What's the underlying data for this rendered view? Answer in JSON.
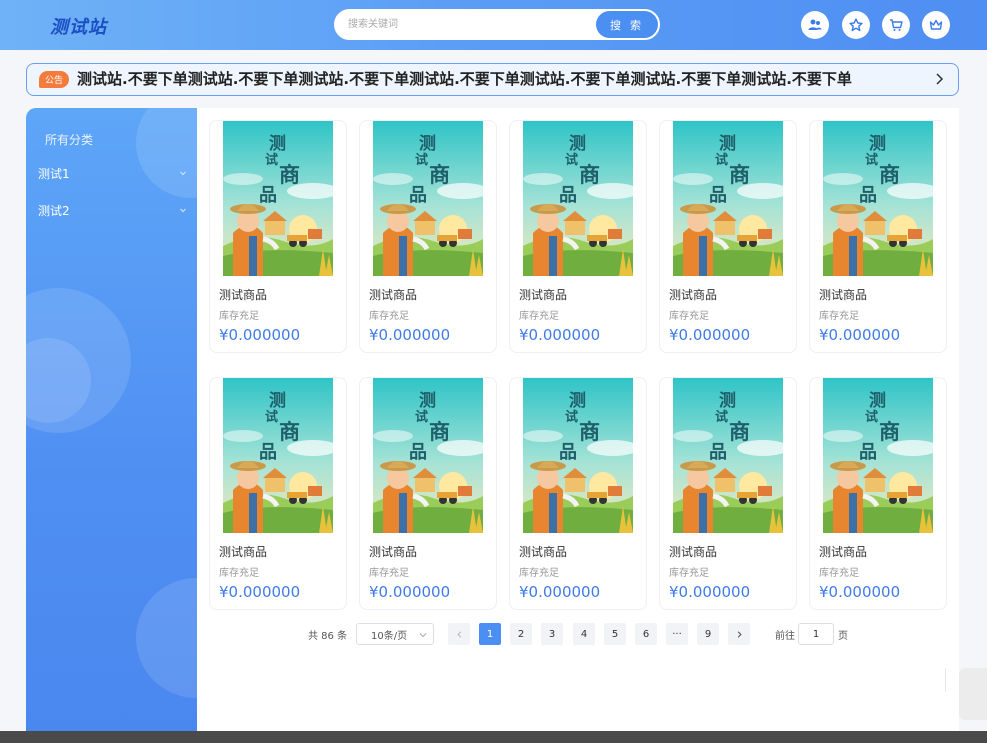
{
  "header": {
    "logo": "测试站",
    "search_placeholder": "搜索关键词",
    "search_button": "搜 索"
  },
  "notice": {
    "tag": "公告",
    "text": "测试站.不要下单测试站.不要下单测试站.不要下单测试站.不要下单测试站.不要下单测试站.不要下单测试站.不要下单"
  },
  "sidebar": {
    "title": "所有分类",
    "items": [
      {
        "label": "测试1"
      },
      {
        "label": "测试2"
      }
    ]
  },
  "products": [
    {
      "name": "测试商品",
      "stock": "库存充足",
      "price": "¥0.000000",
      "poster": [
        "测",
        "试",
        "商",
        "品"
      ]
    },
    {
      "name": "测试商品",
      "stock": "库存充足",
      "price": "¥0.000000",
      "poster": [
        "测",
        "试",
        "商",
        "品"
      ]
    },
    {
      "name": "测试商品",
      "stock": "库存充足",
      "price": "¥0.000000",
      "poster": [
        "测",
        "试",
        "商",
        "品"
      ]
    },
    {
      "name": "测试商品",
      "stock": "库存充足",
      "price": "¥0.000000",
      "poster": [
        "测",
        "试",
        "商",
        "品"
      ]
    },
    {
      "name": "测试商品",
      "stock": "库存充足",
      "price": "¥0.000000",
      "poster": [
        "测",
        "试",
        "商",
        "品"
      ]
    },
    {
      "name": "测试商品",
      "stock": "库存充足",
      "price": "¥0.000000",
      "poster": [
        "测",
        "试",
        "商",
        "品"
      ]
    },
    {
      "name": "测试商品",
      "stock": "库存充足",
      "price": "¥0.000000",
      "poster": [
        "测",
        "试",
        "商",
        "品"
      ]
    },
    {
      "name": "测试商品",
      "stock": "库存充足",
      "price": "¥0.000000",
      "poster": [
        "测",
        "试",
        "商",
        "品"
      ]
    },
    {
      "name": "测试商品",
      "stock": "库存充足",
      "price": "¥0.000000",
      "poster": [
        "测",
        "试",
        "商",
        "品"
      ]
    },
    {
      "name": "测试商品",
      "stock": "库存充足",
      "price": "¥0.000000",
      "poster": [
        "测",
        "试",
        "商",
        "品"
      ]
    }
  ],
  "pagination": {
    "total": "共 86 条",
    "page_size": "10条/页",
    "pages": [
      "1",
      "2",
      "3",
      "4",
      "5",
      "6",
      "···",
      "9"
    ],
    "current": "1",
    "goto_label": "前往",
    "goto_value": "1",
    "page_label": "页"
  },
  "colors": {
    "accent": "#4b8ff3",
    "price": "#3e7be8",
    "notice_tag": "#f57b3d"
  }
}
